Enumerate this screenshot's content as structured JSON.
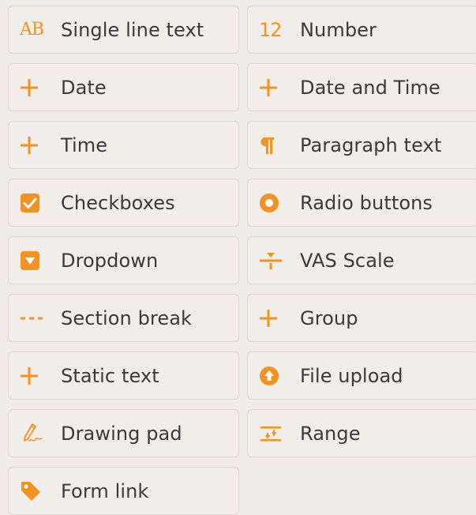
{
  "accent_color": "#f29222",
  "fields": [
    {
      "label": "Single line text",
      "icon": "ab-text-icon"
    },
    {
      "label": "Number",
      "icon": "number-icon"
    },
    {
      "label": "Date",
      "icon": "plus-icon"
    },
    {
      "label": "Date and Time",
      "icon": "plus-icon"
    },
    {
      "label": "Time",
      "icon": "plus-icon"
    },
    {
      "label": "Paragraph text",
      "icon": "pilcrow-icon"
    },
    {
      "label": "Checkboxes",
      "icon": "checkbox-icon"
    },
    {
      "label": "Radio buttons",
      "icon": "radio-icon"
    },
    {
      "label": "Dropdown",
      "icon": "dropdown-icon"
    },
    {
      "label": "VAS Scale",
      "icon": "vas-scale-icon"
    },
    {
      "label": "Section break",
      "icon": "dotted-line-icon"
    },
    {
      "label": "Group",
      "icon": "plus-icon"
    },
    {
      "label": "Static text",
      "icon": "plus-icon"
    },
    {
      "label": "File upload",
      "icon": "upload-icon"
    },
    {
      "label": "Drawing pad",
      "icon": "pencil-icon"
    },
    {
      "label": "Range",
      "icon": "range-icon"
    },
    {
      "label": "Form link",
      "icon": "tag-icon"
    }
  ],
  "icon_text": {
    "ab": "AB",
    "number": "12"
  }
}
